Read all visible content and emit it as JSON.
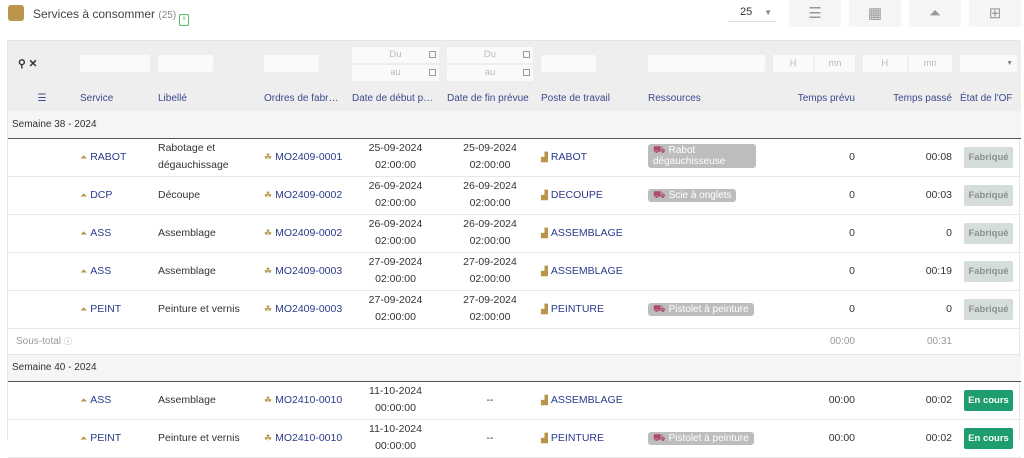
{
  "header": {
    "title": "Services à consommer",
    "count": "(25)",
    "export_icon": "excel-icon",
    "page_size": "25",
    "view_buttons": [
      "list-icon",
      "calendar-icon",
      "service-bell-icon",
      "workstation-icon"
    ]
  },
  "filters": {
    "date_from": "Du",
    "date_to": "au",
    "hour": "H",
    "minute": "mn",
    "sep": ":"
  },
  "columns": [
    "Service",
    "Libellé",
    "Ordres de fabr…",
    "Date de début p…",
    "Date de fin prévue",
    "Poste de travail",
    "Ressources",
    "Temps prévu",
    "Temps passé",
    "État de l'OF"
  ],
  "colors": {
    "fabrique_bg": "#d5dcdc",
    "fabrique_fg": "#8a9090",
    "encours_bg": "#1e9e6e",
    "encours_fg": "#ffffff"
  },
  "groups": [
    {
      "label": "Semaine 38 - 2024",
      "rows": [
        {
          "service": "RABOT",
          "libelle": "Rabotage et dégauchissage",
          "of": "MO2409-0001",
          "start_date": "25-09-2024",
          "start_time": "02:00:00",
          "end_date": "25-09-2024",
          "end_time": "02:00:00",
          "poste": "RABOT",
          "ressource": "Rabot dégauchisseuse",
          "prevu": "0",
          "passe": "00:08",
          "etat": "Fabriqué"
        },
        {
          "service": "DCP",
          "libelle": "Découpe",
          "of": "MO2409-0002",
          "start_date": "26-09-2024",
          "start_time": "02:00:00",
          "end_date": "26-09-2024",
          "end_time": "02:00:00",
          "poste": "DECOUPE",
          "ressource": "Scie à onglets",
          "prevu": "0",
          "passe": "00:03",
          "etat": "Fabriqué"
        },
        {
          "service": "ASS",
          "libelle": "Assemblage",
          "of": "MO2409-0002",
          "start_date": "26-09-2024",
          "start_time": "02:00:00",
          "end_date": "26-09-2024",
          "end_time": "02:00:00",
          "poste": "ASSEMBLAGE",
          "ressource": "",
          "prevu": "0",
          "passe": "0",
          "etat": "Fabriqué"
        },
        {
          "service": "ASS",
          "libelle": "Assemblage",
          "of": "MO2409-0003",
          "start_date": "27-09-2024",
          "start_time": "02:00:00",
          "end_date": "27-09-2024",
          "end_time": "02:00:00",
          "poste": "ASSEMBLAGE",
          "ressource": "",
          "prevu": "0",
          "passe": "00:19",
          "etat": "Fabriqué"
        },
        {
          "service": "PEINT",
          "libelle": "Peinture et vernis",
          "of": "MO2409-0003",
          "start_date": "27-09-2024",
          "start_time": "02:00:00",
          "end_date": "27-09-2024",
          "end_time": "02:00:00",
          "poste": "PEINTURE",
          "ressource": "Pistolet à peinture",
          "prevu": "0",
          "passe": "0",
          "etat": "Fabriqué"
        }
      ],
      "subtotal": {
        "label": "Sous-total",
        "prevu": "00:00",
        "passe": "00:31"
      }
    },
    {
      "label": "Semaine 40 - 2024",
      "rows": [
        {
          "service": "ASS",
          "libelle": "Assemblage",
          "of": "MO2410-0010",
          "start_date": "11-10-2024",
          "start_time": "00:00:00",
          "end_date": "--",
          "end_time": "",
          "poste": "ASSEMBLAGE",
          "ressource": "",
          "prevu": "00:00",
          "passe": "00:02",
          "etat": "En cours"
        },
        {
          "service": "PEINT",
          "libelle": "Peinture et vernis",
          "of": "MO2410-0010",
          "start_date": "11-10-2024",
          "start_time": "00:00:00",
          "end_date": "--",
          "end_time": "",
          "poste": "PEINTURE",
          "ressource": "Pistolet à peinture",
          "prevu": "00:00",
          "passe": "00:02",
          "etat": "En cours"
        }
      ]
    }
  ]
}
